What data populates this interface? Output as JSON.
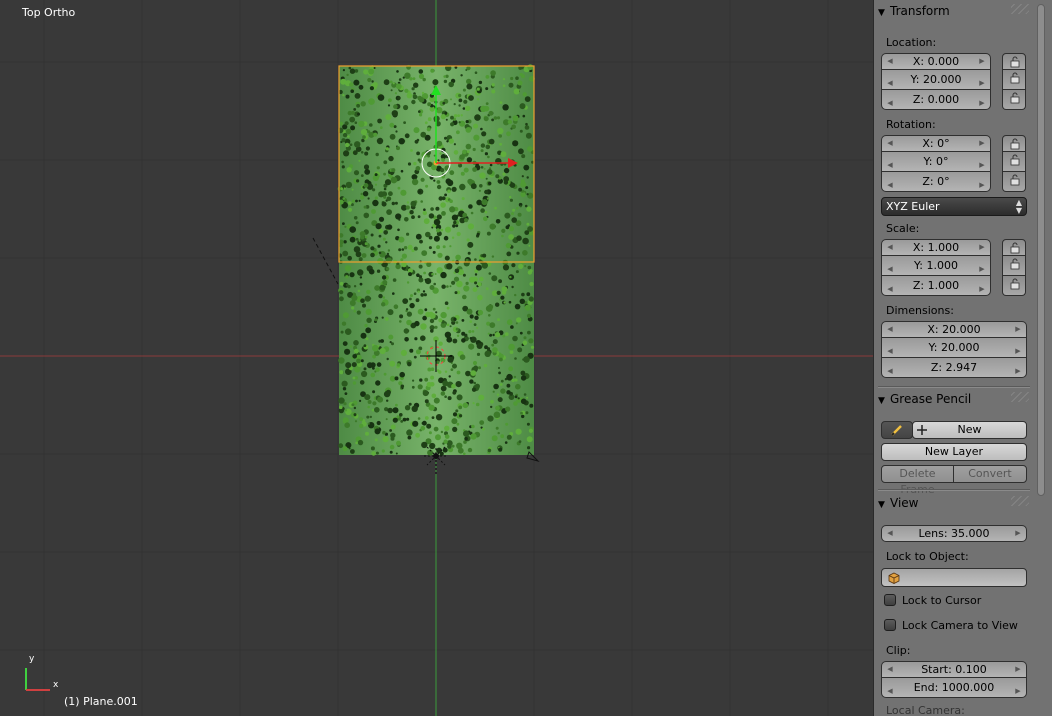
{
  "viewport": {
    "view_name": "Top Ortho",
    "object_name": "(1) Plane.001",
    "axis_y_label": "y",
    "axis_x_label": "x"
  },
  "colors": {
    "viewport_bg": "#393939",
    "panel_bg": "#727272",
    "grass": "#5f9a52",
    "selection": "#f0a030",
    "x_axis": "#c83232",
    "y_axis": "#32c832"
  },
  "panel": {
    "transform": {
      "title": "Transform",
      "location_label": "Location:",
      "location": [
        "X: 0.000",
        "Y: 20.000",
        "Z: 0.000"
      ],
      "rotation_label": "Rotation:",
      "rotation": [
        "X: 0°",
        "Y: 0°",
        "Z: 0°"
      ],
      "rotation_mode": "XYZ Euler",
      "scale_label": "Scale:",
      "scale": [
        "X: 1.000",
        "Y: 1.000",
        "Z: 1.000"
      ],
      "dimensions_label": "Dimensions:",
      "dimensions": [
        "X: 20.000",
        "Y: 20.000",
        "Z: 2.947"
      ]
    },
    "grease_pencil": {
      "title": "Grease Pencil",
      "new_label": "New",
      "new_layer_label": "New Layer",
      "delete_frame_label": "Delete Frame",
      "convert_label": "Convert"
    },
    "view": {
      "title": "View",
      "lens": "Lens: 35.000",
      "lock_to_object_label": "Lock to Object:",
      "lock_to_cursor_label": "Lock to Cursor",
      "lock_camera_label": "Lock Camera to View",
      "clip_label": "Clip:",
      "clip_start": "Start: 0.100",
      "clip_end": "End: 1000.000",
      "local_camera_label": "Local Camera:"
    }
  }
}
